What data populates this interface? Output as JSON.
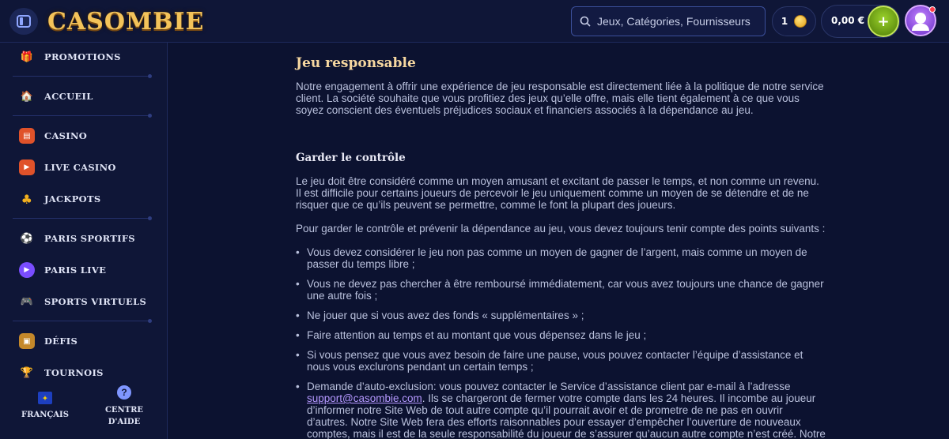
{
  "header": {
    "logo_text": "CASOMBIE",
    "search_placeholder": "Jeux, Catégories, Fournisseurs",
    "coins_count": "1",
    "balance": "0,00 €",
    "wallet_symbol": "+"
  },
  "sidebar": {
    "items": [
      {
        "label": "PROMOTIONS",
        "icon": "gift-icon",
        "glyph": "🎁",
        "color": "#c45bd8"
      },
      {
        "label": "ACCUEIL",
        "icon": "home-icon",
        "glyph": "🏠",
        "color": "#e09a2a"
      },
      {
        "label": "CASINO",
        "icon": "cards-icon",
        "glyph": "🂠",
        "color": "#e0522a"
      },
      {
        "label": "LIVE CASINO",
        "icon": "live-icon",
        "glyph": "▶",
        "color": "#e0522a"
      },
      {
        "label": "JACKPOTS",
        "icon": "clover-icon",
        "glyph": "♣",
        "color": "#f2b01e"
      },
      {
        "label": "PARIS SPORTIFS",
        "icon": "ball-icon",
        "glyph": "⚽",
        "color": "#6f66ff"
      },
      {
        "label": "PARIS LIVE",
        "icon": "live-play-icon",
        "glyph": "▶",
        "color": "#7a4dff"
      },
      {
        "label": "SPORTS VIRTUELS",
        "icon": "gamepad-icon",
        "glyph": "🎮",
        "color": "#8a63ff"
      },
      {
        "label": "DÉFIS",
        "icon": "chest-icon",
        "glyph": "▣",
        "color": "#c4882a"
      },
      {
        "label": "TOURNOIS",
        "icon": "trophy-icon",
        "glyph": "🏆",
        "color": "#e0a21e"
      }
    ],
    "language_label": "FRANÇAIS",
    "help_label_1": "CENTRE",
    "help_label_2": "D'AIDE"
  },
  "main": {
    "title": "Jeu responsable",
    "intro": "Notre engagement à offrir une expérience de jeu responsable est directement liée à la politique de notre service client. La société souhaite que vous profitiez des jeux qu’elle offre, mais elle tient également à ce que vous soyez conscient des éventuels préjudices sociaux et financiers associés à la dépendance au jeu.",
    "section_title": "Garder le contrôle",
    "para1": "Le jeu doit être considéré comme un moyen amusant et excitant de passer le temps, et non comme un revenu. Il est difficile pour certains joueurs de percevoir le jeu uniquement comme un moyen de se détendre et de ne risquer que ce qu’ils peuvent se permettre, comme le font la plupart des joueurs.",
    "para2": "Pour garder le contrôle et prévenir la dépendance au jeu, vous devez toujours tenir compte des points suivants :",
    "bullets": [
      "Vous devez considérer le jeu non pas comme un moyen de gagner de l’argent, mais comme un moyen de passer du temps libre ;",
      "Vous ne devez pas chercher à être remboursé immédiatement, car vous avez toujours une chance de gagner une autre fois ;",
      "Ne jouer que si vous avez des fonds « supplémentaires » ;",
      "Faire attention au temps et au montant que vous dépensez dans le jeu ;",
      "Si vous pensez que vous avez besoin de faire une pause, vous pouvez contacter l’équipe d’assistance et nous vous exclurons pendant un certain temps ;"
    ],
    "last_bullet_before": "Demande d’auto-exclusion: vous pouvez contacter le Service d’assistance client par e-mail à l’adresse ",
    "email": "support@casombie.com",
    "last_bullet_after": ". Ils se chargeront de fermer votre compte dans les 24 heures. Il incombe au joueur d’informer notre Site Web de tout autre compte qu’il pourrait avoir et de prometre de ne pas en ouvrir d’autres. Notre Site Web fera des efforts raisonnables pour essayer d’empêcher l’ouverture de nouveaux comptes, mais il est de la seule responsabilité du joueur de s’assurer qu’aucun autre compte n’est créé. Notre"
  }
}
